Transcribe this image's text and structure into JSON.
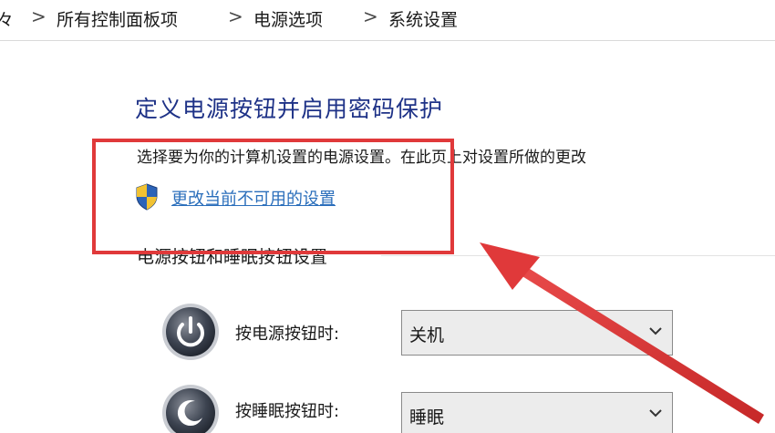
{
  "breadcrumb": {
    "partial": "々",
    "items": [
      "所有控制面板项",
      "电源选项",
      "系统设置"
    ],
    "separator": ">"
  },
  "main": {
    "title": "定义电源按钮并启用密码保护",
    "description": "选择要为你的计算机设置的电源设置。在此页上对设置所做的更改",
    "change_link": "更改当前不可用的设置",
    "section_title": "电源按钮和睡眠按钮设置"
  },
  "settings": {
    "power_button": {
      "label": "按电源按钮时:",
      "value": "关机",
      "icon": "power-icon"
    },
    "sleep_button": {
      "label": "按睡眠按钮时:",
      "value": "睡眠",
      "icon": "sleep-icon"
    }
  },
  "annotation": {
    "highlight_color": "#e0393a"
  },
  "colors": {
    "title": "#1e3287",
    "link": "#2a6ebb",
    "dropdown_bg": "#ececec"
  }
}
